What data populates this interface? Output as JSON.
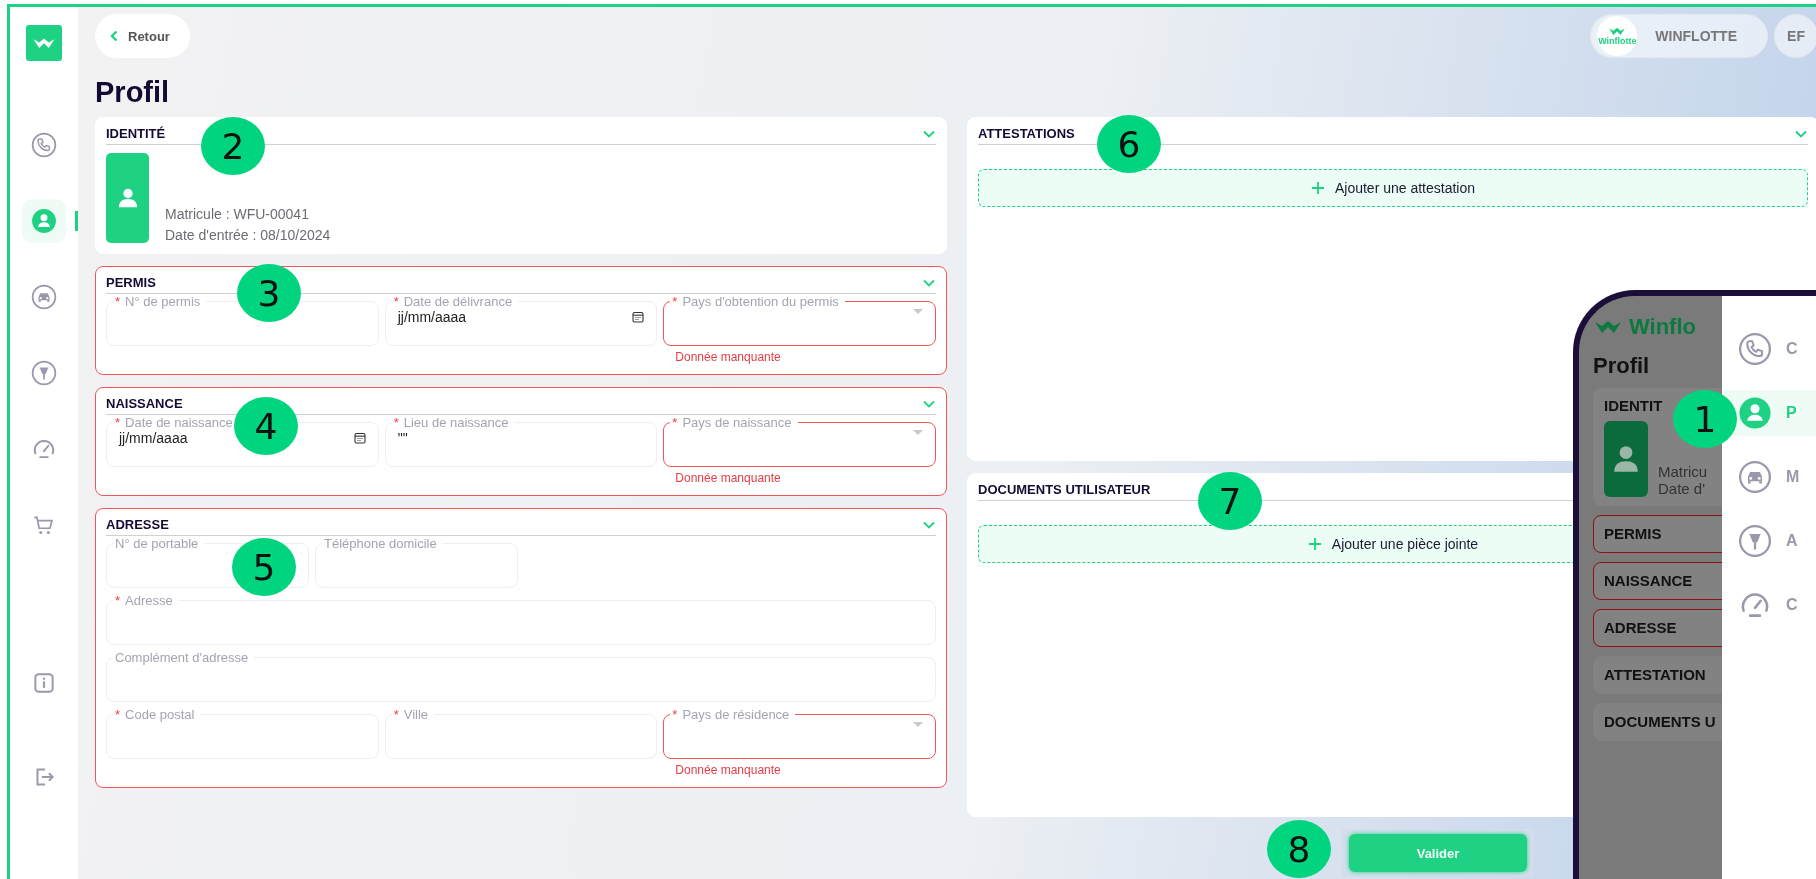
{
  "sidebar": {
    "items": [
      {
        "kind": "phone",
        "selected": false
      },
      {
        "kind": "user",
        "selected": true
      },
      {
        "kind": "car",
        "selected": false
      },
      {
        "kind": "cone",
        "selected": false
      },
      {
        "kind": "gauge",
        "selected": false
      },
      {
        "kind": "cart",
        "selected": false
      }
    ],
    "bottom_items": [
      {
        "kind": "info",
        "selected": false
      },
      {
        "kind": "logout",
        "selected": false
      }
    ]
  },
  "back_button": "Retour",
  "header": {
    "logo_text": "Winflotte",
    "company": "WINFLOTTE",
    "user_initials": "EF"
  },
  "page_title": "Profil",
  "identity": {
    "title": "IDENTITÉ",
    "expanded": true,
    "lines": [
      "Matricule : WFU-00041",
      "Date d'entrée : 08/10/2024"
    ]
  },
  "sections": [
    {
      "title": "PERMIS",
      "expanded": true,
      "invalid": true,
      "rows": [
        [
          {
            "kind": "text",
            "label": "N° de permis",
            "required_mark": "*"
          },
          {
            "kind": "date",
            "label": "Date de délivrance",
            "required_mark": "*",
            "value": "jj/mm/aaaa"
          },
          {
            "kind": "select",
            "label": "Pays d'obtention du permis",
            "required_mark": "*",
            "error": "Donnée manquante"
          }
        ]
      ]
    },
    {
      "title": "NAISSANCE",
      "expanded": true,
      "invalid": true,
      "rows": [
        [
          {
            "kind": "date",
            "label": "Date de naissance",
            "required_mark": "*",
            "value": "jj/mm/aaaa"
          },
          {
            "kind": "text",
            "label": "Lieu de naissance",
            "required_mark": "*",
            "value": "\"\""
          },
          {
            "kind": "select",
            "label": "Pays de naissance",
            "required_mark": "*",
            "error": "Donnée manquante"
          }
        ]
      ]
    },
    {
      "title": "ADRESSE",
      "expanded": true,
      "invalid": true,
      "rows": [
        [
          {
            "kind": "text",
            "label": "N° de portable"
          },
          {
            "kind": "text",
            "label": "Téléphone domicile"
          }
        ],
        [
          {
            "kind": "text",
            "label": "Adresse",
            "required_mark": "*"
          }
        ],
        [
          {
            "kind": "text",
            "label": "Complément d'adresse"
          }
        ],
        [
          {
            "kind": "text",
            "label": "Code postal",
            "required_mark": "*"
          },
          {
            "kind": "text",
            "label": "Ville",
            "required_mark": "*"
          },
          {
            "kind": "select",
            "label": "Pays de résidence",
            "required_mark": "*",
            "error": "Donnée manquante"
          }
        ]
      ]
    }
  ],
  "attestations": {
    "title": "ATTESTATIONS",
    "expanded": true,
    "button": "Ajouter une attestation"
  },
  "documents": {
    "title": "DOCUMENTS UTILISATEUR",
    "button": "Ajouter une pièce jointe"
  },
  "submit_button": "Valider",
  "phone": {
    "logo_text": "Winflo",
    "title": "Profil",
    "identity_title": "IDENTIT",
    "identity_lines": [
      "Matricu",
      "Date d'"
    ],
    "sections": [
      {
        "title": "PERMIS",
        "invalid": true
      },
      {
        "title": "NAISSANCE",
        "invalid": true
      },
      {
        "title": "ADRESSE",
        "invalid": true
      },
      {
        "title": "ATTESTATION",
        "invalid": false
      },
      {
        "title": "DOCUMENTS U",
        "invalid": false
      }
    ],
    "menu": [
      {
        "kind": "phone",
        "label": "C",
        "selected": false
      },
      {
        "kind": "user",
        "label": "P",
        "selected": true
      },
      {
        "kind": "car",
        "label": "M",
        "selected": false
      },
      {
        "kind": "cone",
        "label": "A",
        "selected": false
      },
      {
        "kind": "gauge",
        "label": "C",
        "selected": false
      }
    ]
  },
  "callouts": [
    {
      "number": "2"
    },
    {
      "number": "3"
    },
    {
      "number": "4"
    },
    {
      "number": "5"
    },
    {
      "number": "6"
    },
    {
      "number": "1"
    },
    {
      "number": "7"
    },
    {
      "number": "8"
    }
  ]
}
